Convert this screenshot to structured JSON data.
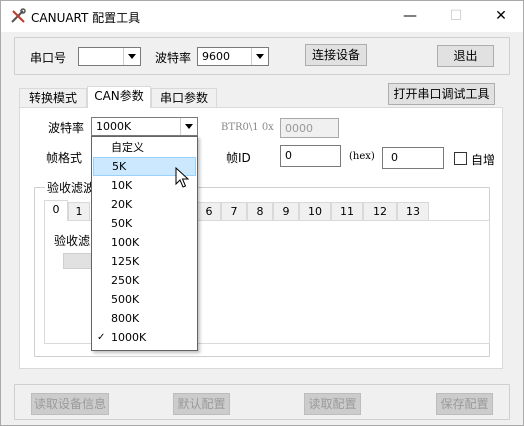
{
  "window": {
    "title": "CANUART 配置工具",
    "minimize_glyph": "—",
    "maximize_glyph": "☐",
    "close_glyph": "✕",
    "app_icon": "wrench-screwdriver-icon"
  },
  "connection": {
    "port_label": "串口号",
    "port_value": "",
    "baud_label": "波特率",
    "baud_value": "9600",
    "connect_button": "连接设备",
    "exit_button": "退出"
  },
  "tabs": [
    "转换模式",
    "CAN参数",
    "串口参数"
  ],
  "selected_tab": "CAN参数",
  "open_debug_button": "打开串口调试工具",
  "can": {
    "baud_label": "波特率",
    "baud_value": "1000K",
    "btr_label": "BTR0\\1 0x",
    "btr_value": "0000",
    "frame_label": "帧格式",
    "frame_id_label": "帧ID",
    "frame_id_value": "0",
    "hex_label": "(hex)",
    "hex_value": "0",
    "auto_inc_label": "自增",
    "auto_inc_checked": false,
    "filter_group_label": "验收滤波",
    "filter_tabs": [
      "0",
      "1",
      "6",
      "7",
      "8",
      "9",
      "10",
      "11",
      "12",
      "13"
    ],
    "filter_inner_label": "验收滤"
  },
  "dropdown": {
    "items": [
      "自定义",
      "5K",
      "10K",
      "20K",
      "50K",
      "100K",
      "125K",
      "250K",
      "500K",
      "800K",
      "1000K"
    ],
    "highlighted": "5K",
    "checked": "1000K",
    "check_glyph": "✓"
  },
  "bottom_buttons": {
    "read_info": "读取设备信息",
    "default_config": "默认配置",
    "read_config": "读取配置",
    "save_config": "保存配置"
  },
  "colors": {
    "highlight": "#cce8ff",
    "highlight_border": "#99d1ff",
    "window_bg": "#f0f0f0"
  }
}
